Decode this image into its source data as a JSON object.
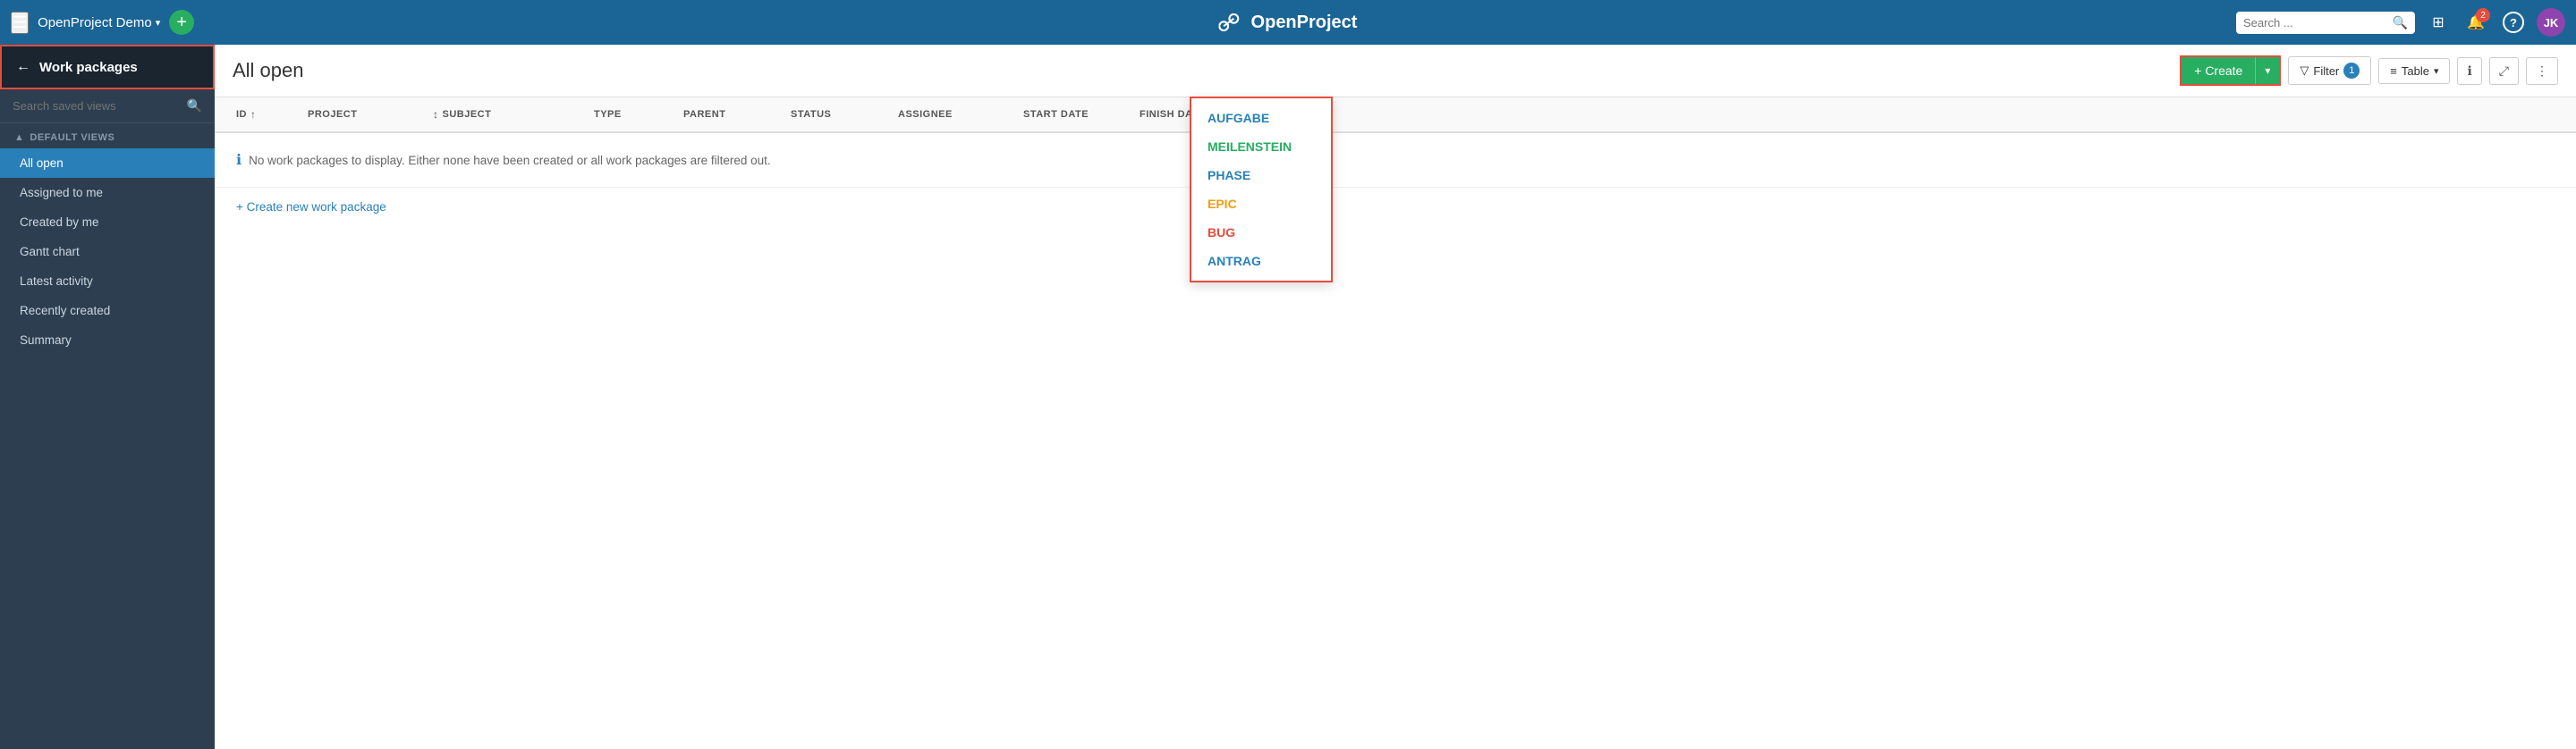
{
  "topnav": {
    "hamburger": "☰",
    "project_name": "OpenProject Demo",
    "project_caret": "▾",
    "plus_label": "+",
    "logo_icon": "⟳",
    "logo_text": "OpenProject",
    "search_placeholder": "Search ...",
    "search_icon": "🔍",
    "grid_icon": "⠿",
    "bell_icon": "🔔",
    "bell_badge": "2",
    "help_icon": "?",
    "avatar_text": "JK"
  },
  "sidebar": {
    "back_arrow": "←",
    "back_label": "Work packages",
    "search_placeholder": "Search saved views",
    "search_icon": "🔍",
    "section_title": "DEFAULT VIEWS",
    "section_caret": "▲",
    "items": [
      {
        "label": "All open",
        "active": true
      },
      {
        "label": "Assigned to me",
        "active": false
      },
      {
        "label": "Created by me",
        "active": false
      },
      {
        "label": "Gantt chart",
        "active": false
      },
      {
        "label": "Latest activity",
        "active": false
      },
      {
        "label": "Recently created",
        "active": false
      },
      {
        "label": "Summary",
        "active": false
      }
    ]
  },
  "content": {
    "page_title": "All open",
    "create_label": "+ Create",
    "create_caret": "▾",
    "filter_label": "Filter",
    "filter_count": "1",
    "filter_icon": "▼",
    "table_label": "Table",
    "table_icon": "≡",
    "table_caret": "▾",
    "info_icon": "ℹ",
    "settings_icon": "⚙",
    "fullscreen_icon": "⤢",
    "more_icon": "⋮",
    "empty_message": "No work packages to display. Either none have been created or all work packages are filtered out.",
    "create_row_label": "+ Create new work package",
    "columns": [
      {
        "label": "ID",
        "sort": "↑"
      },
      {
        "label": "PROJECT",
        "sort": ""
      },
      {
        "label": "SUBJECT",
        "sort": "↕"
      },
      {
        "label": "TYPE",
        "sort": ""
      },
      {
        "label": "PARENT",
        "sort": ""
      },
      {
        "label": "STATUS",
        "sort": ""
      },
      {
        "label": "ASSIGNEE",
        "sort": ""
      },
      {
        "label": "START DATE",
        "sort": ""
      },
      {
        "label": "FINISH DATE",
        "sort": ""
      },
      {
        "label": "⚙",
        "sort": ""
      }
    ]
  },
  "dropdown": {
    "items": [
      {
        "label": "AUFGABE",
        "color": "#2980b9"
      },
      {
        "label": "MEILENSTEIN",
        "color": "#27ae60"
      },
      {
        "label": "PHASE",
        "color": "#2980b9"
      },
      {
        "label": "EPIC",
        "color": "#f39c12"
      },
      {
        "label": "BUG",
        "color": "#e74c3c"
      },
      {
        "label": "ANTRAG",
        "color": "#2980b9"
      }
    ]
  }
}
